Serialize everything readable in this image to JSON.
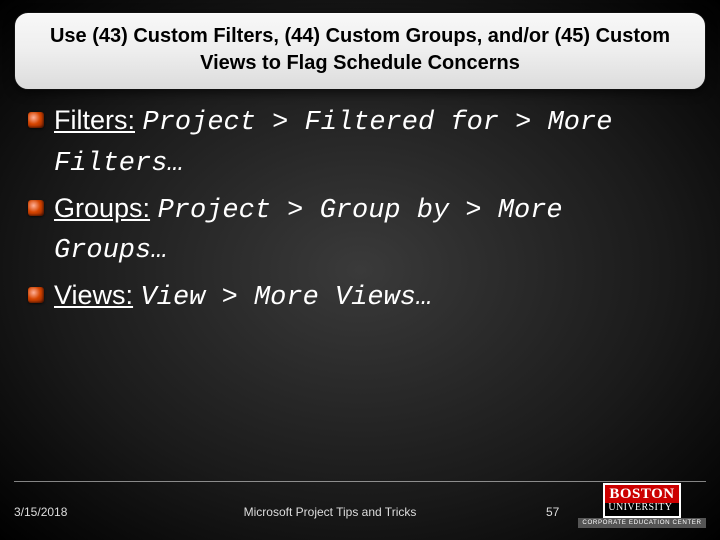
{
  "title": "Use (43) Custom Filters, (44) Custom Groups, and/or (45) Custom Views to Flag Schedule Concerns",
  "items": [
    {
      "label": "Filters:",
      "path": "Project > Filtered for > More Filters…"
    },
    {
      "label": "Groups:",
      "path": "Project > Group by > More Groups…"
    },
    {
      "label": "Views:",
      "path": "View > More Views…"
    }
  ],
  "footer": {
    "date": "3/15/2018",
    "center": "Microsoft Project Tips and Tricks",
    "page": "57"
  },
  "logo": {
    "line1": "BOSTON",
    "line2": "UNIVERSITY",
    "bar": "CORPORATE EDUCATION CENTER"
  }
}
